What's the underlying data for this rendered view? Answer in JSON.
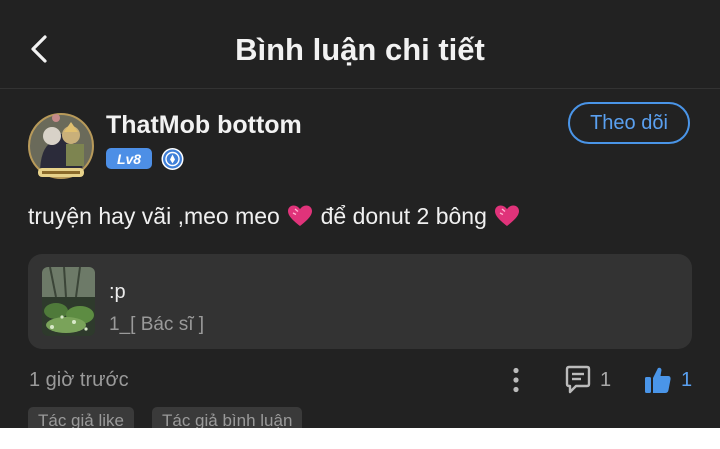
{
  "header": {
    "title": "Bình luận chi tiết"
  },
  "user": {
    "name": "ThatMob bottom",
    "level": "Lv8",
    "follow_label": "Theo dõi"
  },
  "comment": {
    "text_part1": "truyện hay vãi ,meo meo ",
    "text_part2": " để donut 2 bông "
  },
  "chapter": {
    "name": ":p",
    "subtitle": "1_[ Bác sĩ ]"
  },
  "meta": {
    "time": "1 giờ trước",
    "reply_count": "1",
    "like_count": "1"
  },
  "tags": [
    "Tác giả like",
    "Tác giả bình luận"
  ],
  "colors": {
    "background": "#222222",
    "accent": "#4a95e8",
    "card": "#333333",
    "heart": "#e0337a"
  },
  "icons": [
    "back-arrow-icon",
    "medal-icon",
    "heart-icon",
    "more-vertical-icon",
    "comment-icon",
    "thumbs-up-icon"
  ]
}
